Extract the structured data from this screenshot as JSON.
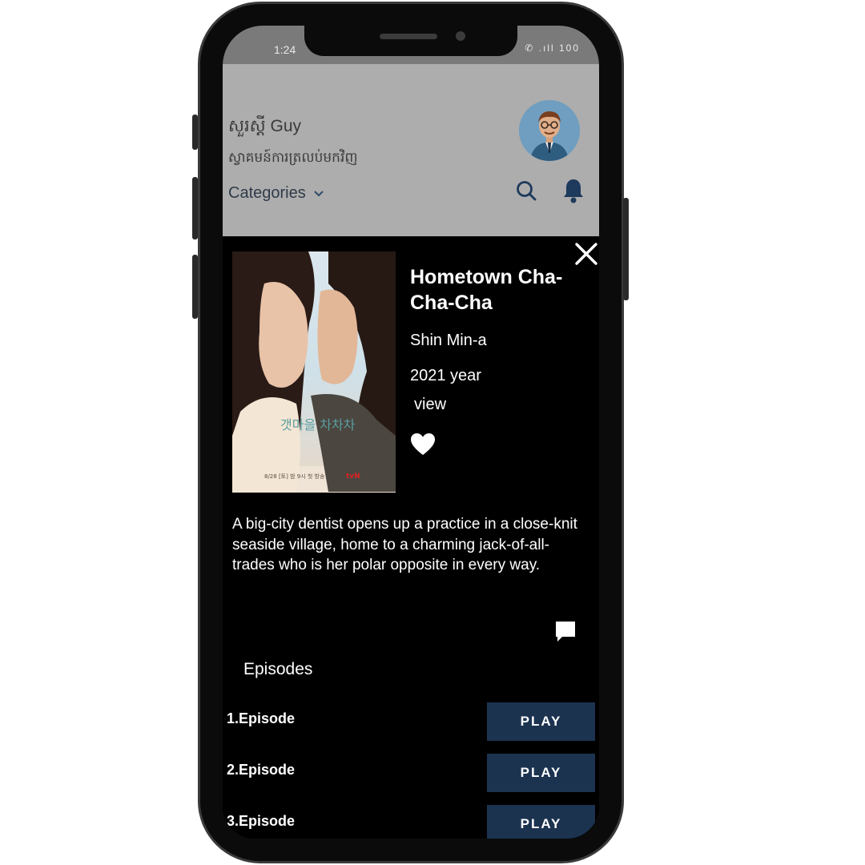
{
  "status_bar": {
    "time": "1:24",
    "icons": "✆ .ıll 100"
  },
  "header": {
    "greeting": "សួរស្តី Guy",
    "subtext": "ស្វាគមន៍ការត្រលប់មកវិញ",
    "categories_label": "Categories",
    "chevron": "⌄"
  },
  "detail": {
    "title": "Hometown Cha-Cha-Cha",
    "actor": "Shin Min-a",
    "year": "2021 year",
    "view_label": "view",
    "description": "A big-city dentist opens up a practice in a close-knit seaside village, home to a charming jack-of-all-trades who is her polar opposite in every way.",
    "poster_text": {
      "korean_title": "갯마을 차차차",
      "date_line": "8/28 [토] 밤 9시 첫 방송",
      "network": "tvN"
    }
  },
  "episodes": {
    "heading": "Episodes",
    "items": [
      {
        "label": "1.Episode",
        "button": "PLAY"
      },
      {
        "label": "2.Episode",
        "button": "PLAY"
      },
      {
        "label": "3.Episode",
        "button": "PLAY"
      }
    ]
  },
  "icons": {
    "search": "search-icon",
    "notifications": "bell-icon",
    "close": "close-icon",
    "favorite": "heart-icon",
    "comments": "comment-icon",
    "categories_dropdown": "chevron-down-icon"
  },
  "colors": {
    "header_bg": "#adadad",
    "sheet_bg": "#000000",
    "play_button_bg": "#1c3350",
    "icon_accent": "#1e3a5c"
  }
}
